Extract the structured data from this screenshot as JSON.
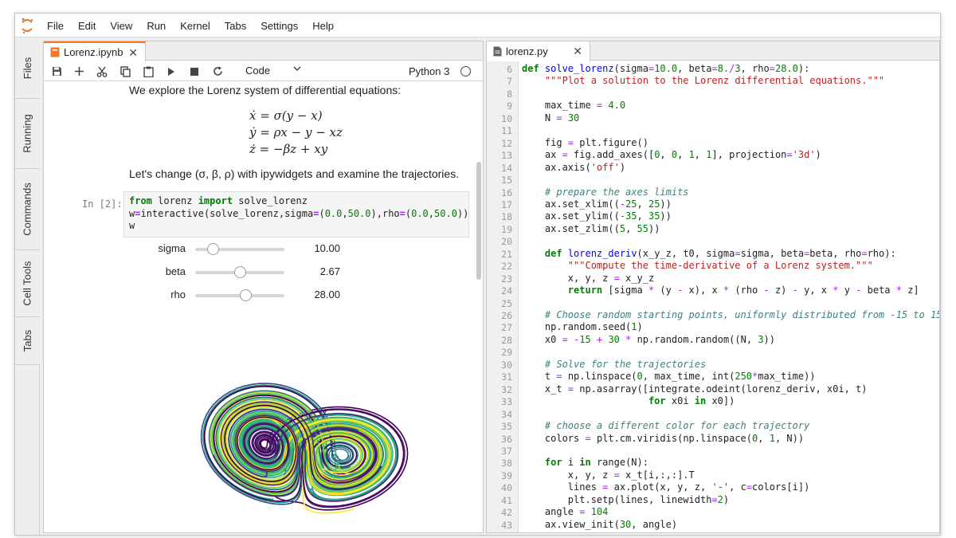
{
  "menu": [
    "File",
    "Edit",
    "View",
    "Run",
    "Kernel",
    "Tabs",
    "Settings",
    "Help"
  ],
  "side_tabs": [
    "Files",
    "Running",
    "Commands",
    "Cell Tools",
    "Tabs"
  ],
  "colors": {
    "accent": "#f37726",
    "code_keyword": "#008000",
    "code_function": "#0000ff",
    "code_string": "#ba2121",
    "code_comment": "#408080",
    "code_operator": "#aa22ff"
  },
  "notebook": {
    "tab_title": "Lorenz.ipynb",
    "toolbar": {
      "icons": [
        "save-icon",
        "add-icon",
        "cut-icon",
        "copy-icon",
        "paste-icon",
        "run-icon",
        "stop-icon",
        "restart-icon"
      ],
      "cell_type": "Code",
      "kernel": "Python 3"
    },
    "intro": "We explore the Lorenz system of differential equations:",
    "equations": [
      "ẋ = σ(y − x)",
      "ẏ = ρx − y − xz",
      "ż = −βz + xy"
    ],
    "change_text": "Let's change (σ, β, ρ) with ipywidgets and examine the trajectories.",
    "cell_prompt": "In [2]:",
    "sliders": [
      {
        "label": "sigma",
        "value": "10.00",
        "level": 0.2
      },
      {
        "label": "beta",
        "value": "2.67",
        "level": 0.5
      },
      {
        "label": "rho",
        "value": "28.00",
        "level": 0.56
      }
    ]
  },
  "editor": {
    "tab_title": "lorenz.py",
    "lines": [
      {
        "n": "6",
        "tokens": [
          [
            "kw",
            "def "
          ],
          [
            "def",
            "solve_lorenz"
          ],
          [
            "nm",
            "(sigma"
          ],
          [
            "op",
            "="
          ],
          [
            "num",
            "10.0"
          ],
          [
            "nm",
            ", beta"
          ],
          [
            "op",
            "="
          ],
          [
            "num",
            "8."
          ],
          [
            "op",
            "/"
          ],
          [
            "num",
            "3"
          ],
          [
            "nm",
            ", rho"
          ],
          [
            "op",
            "="
          ],
          [
            "num",
            "28.0"
          ],
          [
            "nm",
            "):"
          ]
        ]
      },
      {
        "n": "7",
        "tokens": [
          [
            "nm",
            "    "
          ],
          [
            "str",
            "\"\"\"Plot a solution to the Lorenz differential equations.\"\"\""
          ]
        ]
      },
      {
        "n": "8",
        "tokens": []
      },
      {
        "n": "9",
        "tokens": [
          [
            "nm",
            "    max_time "
          ],
          [
            "op",
            "="
          ],
          [
            "num",
            " 4.0"
          ]
        ]
      },
      {
        "n": "10",
        "tokens": [
          [
            "nm",
            "    N "
          ],
          [
            "op",
            "="
          ],
          [
            "num",
            " 30"
          ]
        ]
      },
      {
        "n": "11",
        "tokens": []
      },
      {
        "n": "12",
        "tokens": [
          [
            "nm",
            "    fig "
          ],
          [
            "op",
            "="
          ],
          [
            "nm",
            " plt.figure()"
          ]
        ]
      },
      {
        "n": "13",
        "tokens": [
          [
            "nm",
            "    ax "
          ],
          [
            "op",
            "="
          ],
          [
            "nm",
            " fig.add_axes(["
          ],
          [
            "num",
            "0"
          ],
          [
            "nm",
            ", "
          ],
          [
            "num",
            "0"
          ],
          [
            "nm",
            ", "
          ],
          [
            "num",
            "1"
          ],
          [
            "nm",
            ", "
          ],
          [
            "num",
            "1"
          ],
          [
            "nm",
            "], projection"
          ],
          [
            "op",
            "="
          ],
          [
            "str",
            "'3d'"
          ],
          [
            "nm",
            ")"
          ]
        ]
      },
      {
        "n": "14",
        "tokens": [
          [
            "nm",
            "    ax.axis("
          ],
          [
            "str",
            "'off'"
          ],
          [
            "nm",
            ")"
          ]
        ]
      },
      {
        "n": "15",
        "tokens": []
      },
      {
        "n": "16",
        "tokens": [
          [
            "cmt",
            "    # prepare the axes limits"
          ]
        ]
      },
      {
        "n": "17",
        "tokens": [
          [
            "nm",
            "    ax.set_xlim(("
          ],
          [
            "op",
            "-"
          ],
          [
            "num",
            "25"
          ],
          [
            "nm",
            ", "
          ],
          [
            "num",
            "25"
          ],
          [
            "nm",
            "))"
          ]
        ]
      },
      {
        "n": "18",
        "tokens": [
          [
            "nm",
            "    ax.set_ylim(("
          ],
          [
            "op",
            "-"
          ],
          [
            "num",
            "35"
          ],
          [
            "nm",
            ", "
          ],
          [
            "num",
            "35"
          ],
          [
            "nm",
            "))"
          ]
        ]
      },
      {
        "n": "19",
        "tokens": [
          [
            "nm",
            "    ax.set_zlim(("
          ],
          [
            "num",
            "5"
          ],
          [
            "nm",
            ", "
          ],
          [
            "num",
            "55"
          ],
          [
            "nm",
            "))"
          ]
        ]
      },
      {
        "n": "20",
        "tokens": []
      },
      {
        "n": "21",
        "tokens": [
          [
            "nm",
            "    "
          ],
          [
            "kw",
            "def "
          ],
          [
            "def",
            "lorenz_deriv"
          ],
          [
            "nm",
            "(x_y_z, t0, sigma"
          ],
          [
            "op",
            "="
          ],
          [
            "nm",
            "sigma, beta"
          ],
          [
            "op",
            "="
          ],
          [
            "nm",
            "beta, rho"
          ],
          [
            "op",
            "="
          ],
          [
            "nm",
            "rho):"
          ]
        ]
      },
      {
        "n": "22",
        "tokens": [
          [
            "nm",
            "        "
          ],
          [
            "str",
            "\"\"\"Compute the time-derivative of a Lorenz system.\"\"\""
          ]
        ]
      },
      {
        "n": "23",
        "tokens": [
          [
            "nm",
            "        x, y, z "
          ],
          [
            "op",
            "="
          ],
          [
            "nm",
            " x_y_z"
          ]
        ]
      },
      {
        "n": "24",
        "tokens": [
          [
            "nm",
            "        "
          ],
          [
            "kw",
            "return"
          ],
          [
            "nm",
            " [sigma "
          ],
          [
            "op",
            "*"
          ],
          [
            "nm",
            " (y "
          ],
          [
            "op",
            "-"
          ],
          [
            "nm",
            " x), x "
          ],
          [
            "op",
            "*"
          ],
          [
            "nm",
            " (rho "
          ],
          [
            "op",
            "-"
          ],
          [
            "nm",
            " z) "
          ],
          [
            "op",
            "-"
          ],
          [
            "nm",
            " y, x "
          ],
          [
            "op",
            "*"
          ],
          [
            "nm",
            " y "
          ],
          [
            "op",
            "-"
          ],
          [
            "nm",
            " beta "
          ],
          [
            "op",
            "*"
          ],
          [
            "nm",
            " z]"
          ]
        ]
      },
      {
        "n": "25",
        "tokens": []
      },
      {
        "n": "26",
        "tokens": [
          [
            "cmt",
            "    # Choose random starting points, uniformly distributed from -15 to 15"
          ]
        ]
      },
      {
        "n": "27",
        "tokens": [
          [
            "nm",
            "    np.random.seed("
          ],
          [
            "num",
            "1"
          ],
          [
            "nm",
            ")"
          ]
        ]
      },
      {
        "n": "28",
        "tokens": [
          [
            "nm",
            "    x0 "
          ],
          [
            "op",
            "="
          ],
          [
            "nm",
            " "
          ],
          [
            "op",
            "-"
          ],
          [
            "num",
            "15"
          ],
          [
            "nm",
            " "
          ],
          [
            "op",
            "+"
          ],
          [
            "nm",
            " "
          ],
          [
            "num",
            "30"
          ],
          [
            "nm",
            " "
          ],
          [
            "op",
            "*"
          ],
          [
            "nm",
            " np.random.random((N, "
          ],
          [
            "num",
            "3"
          ],
          [
            "nm",
            "))"
          ]
        ]
      },
      {
        "n": "29",
        "tokens": []
      },
      {
        "n": "30",
        "tokens": [
          [
            "cmt",
            "    # Solve for the trajectories"
          ]
        ]
      },
      {
        "n": "31",
        "tokens": [
          [
            "nm",
            "    t "
          ],
          [
            "op",
            "="
          ],
          [
            "nm",
            " np.linspace("
          ],
          [
            "num",
            "0"
          ],
          [
            "nm",
            ", max_time, int("
          ],
          [
            "num",
            "250"
          ],
          [
            "op",
            "*"
          ],
          [
            "nm",
            "max_time))"
          ]
        ]
      },
      {
        "n": "32",
        "tokens": [
          [
            "nm",
            "    x_t "
          ],
          [
            "op",
            "="
          ],
          [
            "nm",
            " np.asarray([integrate.odeint(lorenz_deriv, x0i, t)"
          ]
        ]
      },
      {
        "n": "33",
        "tokens": [
          [
            "nm",
            "                      "
          ],
          [
            "kw",
            "for"
          ],
          [
            "nm",
            " x0i "
          ],
          [
            "kw",
            "in"
          ],
          [
            "nm",
            " x0])"
          ]
        ]
      },
      {
        "n": "34",
        "tokens": []
      },
      {
        "n": "35",
        "tokens": [
          [
            "cmt",
            "    # choose a different color for each trajectory"
          ]
        ]
      },
      {
        "n": "36",
        "tokens": [
          [
            "nm",
            "    colors "
          ],
          [
            "op",
            "="
          ],
          [
            "nm",
            " plt.cm.viridis(np.linspace("
          ],
          [
            "num",
            "0"
          ],
          [
            "nm",
            ", "
          ],
          [
            "num",
            "1"
          ],
          [
            "nm",
            ", N))"
          ]
        ]
      },
      {
        "n": "37",
        "tokens": []
      },
      {
        "n": "38",
        "tokens": [
          [
            "nm",
            "    "
          ],
          [
            "kw",
            "for"
          ],
          [
            "nm",
            " i "
          ],
          [
            "kw",
            "in"
          ],
          [
            "nm",
            " range(N):"
          ]
        ]
      },
      {
        "n": "39",
        "tokens": [
          [
            "nm",
            "        x, y, z "
          ],
          [
            "op",
            "="
          ],
          [
            "nm",
            " x_t[i,:,:].T"
          ]
        ]
      },
      {
        "n": "40",
        "tokens": [
          [
            "nm",
            "        lines "
          ],
          [
            "op",
            "="
          ],
          [
            "nm",
            " ax.plot(x, y, z, "
          ],
          [
            "str",
            "'-'"
          ],
          [
            "nm",
            ", c"
          ],
          [
            "op",
            "="
          ],
          [
            "nm",
            "colors[i])"
          ]
        ]
      },
      {
        "n": "41",
        "tokens": [
          [
            "nm",
            "        plt.setp(lines, linewidth"
          ],
          [
            "op",
            "="
          ],
          [
            "num",
            "2"
          ],
          [
            "nm",
            ")"
          ]
        ]
      },
      {
        "n": "42",
        "tokens": [
          [
            "nm",
            "    angle "
          ],
          [
            "op",
            "="
          ],
          [
            "num",
            " 104"
          ]
        ]
      },
      {
        "n": "43",
        "tokens": [
          [
            "nm",
            "    ax.view_init("
          ],
          [
            "num",
            "30"
          ],
          [
            "nm",
            ", angle)"
          ]
        ]
      }
    ]
  }
}
